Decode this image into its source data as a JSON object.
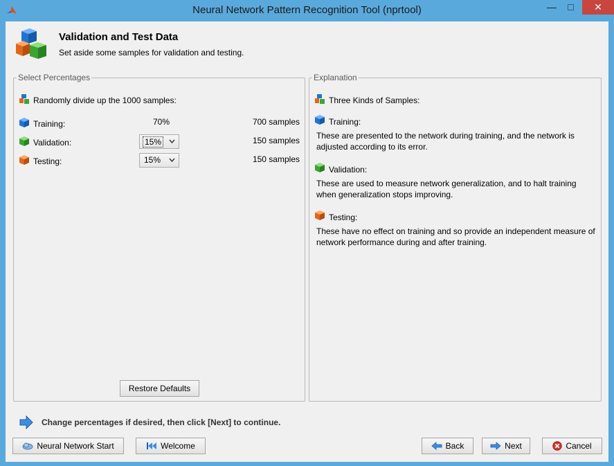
{
  "window": {
    "title": "Neural Network Pattern Recognition Tool (nprtool)",
    "minimize_glyph": "—",
    "maximize_glyph": "□",
    "close_glyph": "✕"
  },
  "header": {
    "title": "Validation and Test Data",
    "subtitle": "Set aside some samples for validation and testing."
  },
  "left_panel": {
    "legend": "Select Percentages",
    "intro": "Randomly divide up the 1000 samples:",
    "rows": [
      {
        "label": "Training:",
        "percent": "70%",
        "samples": "700 samples",
        "color": "#1f74d1"
      },
      {
        "label": "Validation:",
        "percent": "15%",
        "samples": "150 samples",
        "color": "#3aa631"
      },
      {
        "label": "Testing:",
        "percent": "15%",
        "samples": "150 samples",
        "color": "#e0661a"
      }
    ],
    "restore_label": "Restore Defaults"
  },
  "right_panel": {
    "legend": "Explanation",
    "intro": "Three Kinds of Samples:",
    "sections": [
      {
        "heading": "Training:",
        "text": "These are presented to the network during training, and the network is adjusted according to its error."
      },
      {
        "heading": "Validation:",
        "text": "These are used to measure network generalization, and to halt training when generalization stops improving."
      },
      {
        "heading": "Testing:",
        "text": "These have no effect on training and so provide an independent measure of network performance during and after training."
      }
    ]
  },
  "hint": "Change percentages if desired, then click [Next] to continue.",
  "footer": {
    "nn_start": "Neural Network Start",
    "welcome": "Welcome",
    "back": "Back",
    "next": "Next",
    "cancel": "Cancel"
  }
}
